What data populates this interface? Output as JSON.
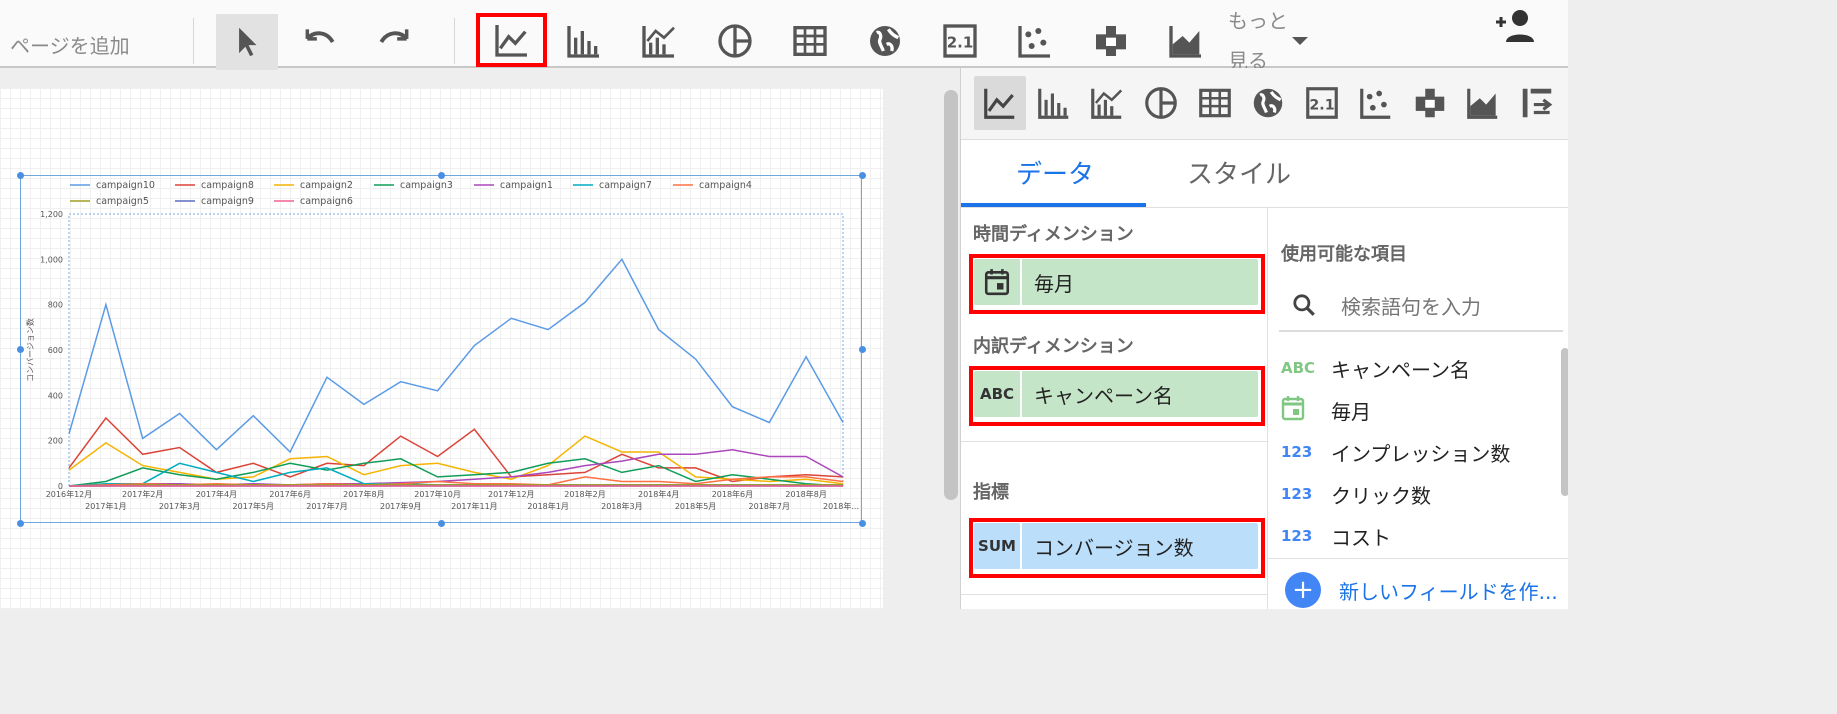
{
  "toolbar": {
    "add_page": "ページを追加",
    "more_label_line1": "もっと",
    "more_label_line2": "見る",
    "chart_icons": [
      "time-series-icon",
      "bar-chart-icon",
      "combo-chart-icon",
      "pie-chart-icon",
      "table-icon",
      "geo-map-icon",
      "scorecard-icon",
      "scatter-chart-icon",
      "pivot-table-icon",
      "area-chart-icon"
    ]
  },
  "panel": {
    "tabs": {
      "data": "データ",
      "style": "スタイル"
    },
    "time_dimension_label": "時間ディメンション",
    "time_dimension_value": "毎月",
    "breakdown_dimension_label": "内訳ディメンション",
    "breakdown_dimension_type": "ABC",
    "breakdown_dimension_value": "キャンペーン名",
    "metric_label": "指標",
    "metric_type": "SUM",
    "metric_value": "コンバージョン数",
    "available_fields_label": "使用可能な項目",
    "search_placeholder": "検索語句を入力",
    "available_fields": [
      {
        "type": "ABC",
        "label": "キャンペーン名"
      },
      {
        "type": "date",
        "label": "毎月"
      },
      {
        "type": "123",
        "label": "インプレッション数"
      },
      {
        "type": "123",
        "label": "クリック数"
      },
      {
        "type": "123",
        "label": "コスト"
      }
    ],
    "new_field": "新しいフィールドを作..."
  },
  "colors": {
    "highlight": "#ff0000",
    "green_chip": "#c5e5c8",
    "blue_chip": "#bbdefb",
    "tab_accent": "#1a73e8",
    "dimension_type": "#81c784",
    "metric_type": "#4285f4"
  },
  "chart_data": {
    "type": "line",
    "ylabel": "コンバージョン数",
    "ylim": [
      0,
      1200
    ],
    "yticks": [
      "0",
      "200",
      "400",
      "600",
      "800",
      "1,000",
      "1,200"
    ],
    "x": [
      "2016年12月",
      "2017年1月",
      "2017年2月",
      "2017年3月",
      "2017年4月",
      "2017年5月",
      "2017年6月",
      "2017年7月",
      "2017年8月",
      "2017年9月",
      "2017年10月",
      "2017年11月",
      "2017年12月",
      "2018年1月",
      "2018年2月",
      "2018年3月",
      "2018年4月",
      "2018年5月",
      "2018年6月",
      "2018年7月",
      "2018年8月",
      "2018年..."
    ],
    "legend_position": "top",
    "series": [
      {
        "name": "campaign10",
        "color": "#5b9be6",
        "values": [
          230,
          800,
          210,
          320,
          160,
          310,
          150,
          480,
          360,
          460,
          420,
          620,
          740,
          690,
          810,
          1000,
          690,
          560,
          350,
          280,
          570,
          280
        ]
      },
      {
        "name": "campaign8",
        "color": "#db4437",
        "values": [
          80,
          300,
          140,
          170,
          60,
          100,
          40,
          100,
          90,
          220,
          130,
          250,
          40,
          50,
          60,
          140,
          80,
          80,
          20,
          40,
          50,
          40
        ]
      },
      {
        "name": "campaign2",
        "color": "#f4b400",
        "values": [
          70,
          190,
          90,
          60,
          30,
          40,
          120,
          130,
          50,
          90,
          100,
          60,
          30,
          90,
          220,
          150,
          150,
          40,
          30,
          20,
          30,
          10
        ]
      },
      {
        "name": "campaign3",
        "color": "#0f9d58",
        "values": [
          0,
          20,
          80,
          50,
          30,
          60,
          100,
          70,
          100,
          120,
          40,
          50,
          60,
          100,
          120,
          60,
          90,
          20,
          50,
          30,
          10,
          0
        ]
      },
      {
        "name": "campaign1",
        "color": "#ab47bc",
        "values": [
          0,
          5,
          10,
          10,
          5,
          10,
          5,
          10,
          10,
          15,
          20,
          30,
          40,
          60,
          90,
          110,
          140,
          140,
          160,
          130,
          130,
          40
        ]
      },
      {
        "name": "campaign7",
        "color": "#00acc1",
        "values": [
          0,
          10,
          10,
          100,
          60,
          20,
          60,
          80,
          10,
          10,
          5,
          5,
          5,
          5,
          5,
          5,
          5,
          5,
          5,
          5,
          5,
          5
        ]
      },
      {
        "name": "campaign4",
        "color": "#ff7043",
        "values": [
          0,
          5,
          10,
          5,
          10,
          5,
          5,
          10,
          5,
          10,
          20,
          10,
          10,
          5,
          40,
          20,
          20,
          10,
          30,
          40,
          40,
          20
        ]
      },
      {
        "name": "campaign5",
        "color": "#9e9d24",
        "values": [
          0,
          0,
          5,
          5,
          5,
          5,
          5,
          5,
          5,
          5,
          5,
          5,
          5,
          5,
          5,
          5,
          5,
          5,
          5,
          5,
          5,
          5
        ]
      },
      {
        "name": "campaign9",
        "color": "#5c6bc0",
        "values": [
          0,
          0,
          0,
          0,
          0,
          0,
          0,
          0,
          0,
          0,
          0,
          0,
          0,
          0,
          0,
          0,
          0,
          0,
          0,
          0,
          0,
          0
        ]
      },
      {
        "name": "campaign6",
        "color": "#f06292",
        "values": [
          0,
          0,
          0,
          0,
          0,
          0,
          0,
          0,
          0,
          0,
          0,
          0,
          0,
          0,
          0,
          0,
          0,
          0,
          0,
          0,
          0,
          0
        ]
      }
    ]
  }
}
